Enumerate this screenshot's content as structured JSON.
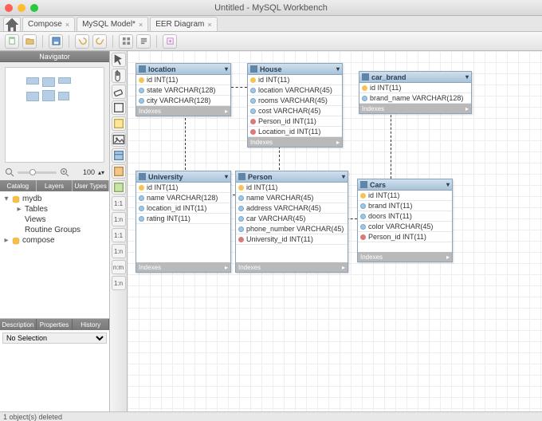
{
  "window": {
    "title": "Untitled - MySQL Workbench"
  },
  "tabs": [
    {
      "label": "Compose"
    },
    {
      "label": "MySQL Model*"
    },
    {
      "label": "EER Diagram"
    }
  ],
  "navigator": {
    "title": "Navigator"
  },
  "zoom": {
    "value": "100"
  },
  "catalog_tabs": [
    "Catalog",
    "Layers",
    "User Types"
  ],
  "tree": {
    "root": "mydb",
    "children": [
      "Tables",
      "Views",
      "Routine Groups"
    ],
    "second_root": "compose"
  },
  "desc_tabs": [
    "Description",
    "Properties",
    "History"
  ],
  "desc_select": "No Selection",
  "vtb_labels": [
    "▶",
    "",
    "",
    "",
    "",
    "/",
    "1:1",
    "1:n",
    "1:1",
    "1:n",
    "n:m",
    "1:n"
  ],
  "entities": {
    "location": {
      "name": "location",
      "rows": [
        {
          "t": "key",
          "txt": "id INT(11)"
        },
        {
          "t": "col",
          "txt": "state VARCHAR(128)"
        },
        {
          "t": "col",
          "txt": "city VARCHAR(128)"
        }
      ],
      "idx": "Indexes"
    },
    "house": {
      "name": "House",
      "rows": [
        {
          "t": "key",
          "txt": "id INT(11)"
        },
        {
          "t": "col",
          "txt": "location VARCHAR(45)"
        },
        {
          "t": "col",
          "txt": "rooms VARCHAR(45)"
        },
        {
          "t": "col",
          "txt": "cost VARCHAR(45)"
        },
        {
          "t": "fk",
          "txt": "Person_id INT(11)"
        },
        {
          "t": "fk",
          "txt": "Location_id INT(11)"
        }
      ],
      "idx": "Indexes"
    },
    "car_brand": {
      "name": "car_brand",
      "rows": [
        {
          "t": "key",
          "txt": "id INT(11)"
        },
        {
          "t": "col",
          "txt": "brand_name VARCHAR(128)"
        }
      ],
      "idx": "Indexes"
    },
    "university": {
      "name": "University",
      "rows": [
        {
          "t": "key",
          "txt": "id INT(11)"
        },
        {
          "t": "col",
          "txt": "name VARCHAR(128)"
        },
        {
          "t": "col",
          "txt": "location_id INT(11)"
        },
        {
          "t": "col",
          "txt": "rating INT(11)"
        }
      ],
      "idx": "Indexes"
    },
    "person": {
      "name": "Person",
      "rows": [
        {
          "t": "key",
          "txt": "id INT(11)"
        },
        {
          "t": "col",
          "txt": "name VARCHAR(45)"
        },
        {
          "t": "col",
          "txt": "address VARCHAR(45)"
        },
        {
          "t": "col",
          "txt": "car VARCHAR(45)"
        },
        {
          "t": "col",
          "txt": "phone_number VARCHAR(45)"
        },
        {
          "t": "fk",
          "txt": "University_id INT(11)"
        }
      ],
      "idx": "Indexes"
    },
    "cars": {
      "name": "Cars",
      "rows": [
        {
          "t": "key",
          "txt": "id INT(11)"
        },
        {
          "t": "col",
          "txt": "brand INT(11)"
        },
        {
          "t": "col",
          "txt": "doors INT(11)"
        },
        {
          "t": "col",
          "txt": "color VARCHAR(45)"
        },
        {
          "t": "fk",
          "txt": "Person_id INT(11)"
        }
      ],
      "idx": "Indexes"
    }
  },
  "status": "1 object(s) deleted"
}
